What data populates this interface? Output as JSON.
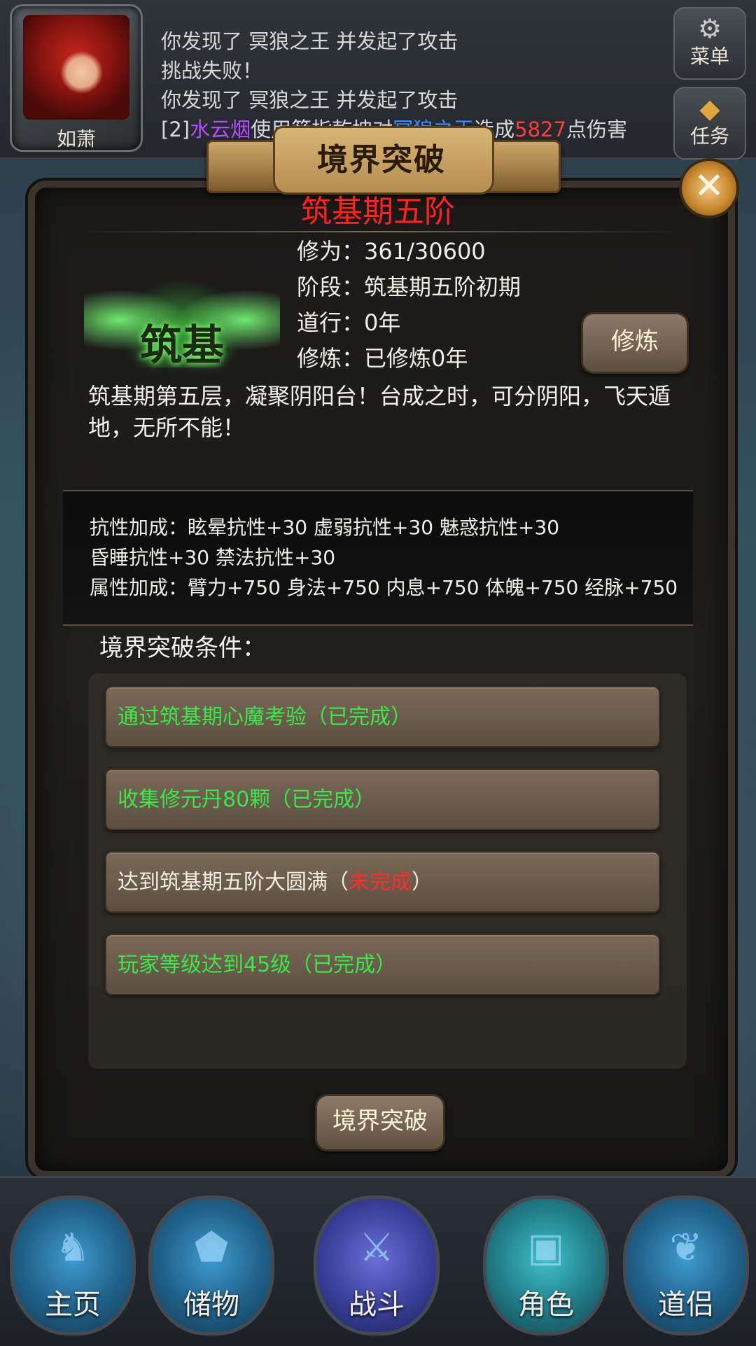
{
  "player": {
    "name": "如萧"
  },
  "chat": {
    "lines": [
      "你发现了 冥狼之王 并发起了攻击",
      "挑战失败！",
      "你发现了 冥狼之王 并发起了攻击"
    ],
    "line4": {
      "prefix": "[2]",
      "actor": "水云烟",
      "mid": "使用箭指乾坤对",
      "target": "冥狼之王",
      "verb": "造成",
      "damage": "5827",
      "suffix": "点伤害"
    }
  },
  "side_buttons": {
    "menu": "菜单",
    "task": "任务"
  },
  "modal": {
    "title": "境界突破",
    "realm": "筑基期五阶",
    "emblem_text": "筑基",
    "stats": [
      "修为：361/30600",
      "阶段：筑基期五阶初期",
      "道行：0年",
      "修炼：已修炼0年"
    ],
    "cultivate_button": "修炼",
    "description": "筑基期第五层，凝聚阴阳台！台成之时，可分阴阳，飞天遁地，无所不能！",
    "bonus_lines": [
      "抗性加成：眩晕抗性+30 虚弱抗性+30 魅惑抗性+30",
      "昏睡抗性+30 禁法抗性+30",
      "属性加成：臂力+750 身法+750 内息+750 体魄+750 经脉+750"
    ],
    "conditions_title": "境界突破条件：",
    "conditions": [
      {
        "text": "通过筑基期心魔考验（已完成）",
        "done": true
      },
      {
        "text": "收集修元丹80颗（已完成）",
        "done": true
      },
      {
        "text_pre": "达到筑基期五阶大圆满（",
        "status": "未完成",
        "text_post": "）",
        "done": false
      },
      {
        "text": "玩家等级达到45级（已完成）",
        "done": true
      }
    ],
    "breakthrough_button": "境界突破"
  },
  "bottom_nav": [
    "主页",
    "储物",
    "战斗",
    "角色",
    "道侣"
  ],
  "colors": {
    "realm_red": "#ff2020",
    "complete_green": "#39e84a",
    "incomplete_red": "#ff2a2a"
  },
  "icons": {
    "menu": "gear-icon",
    "task": "diamond-icon",
    "close": "close-icon"
  }
}
